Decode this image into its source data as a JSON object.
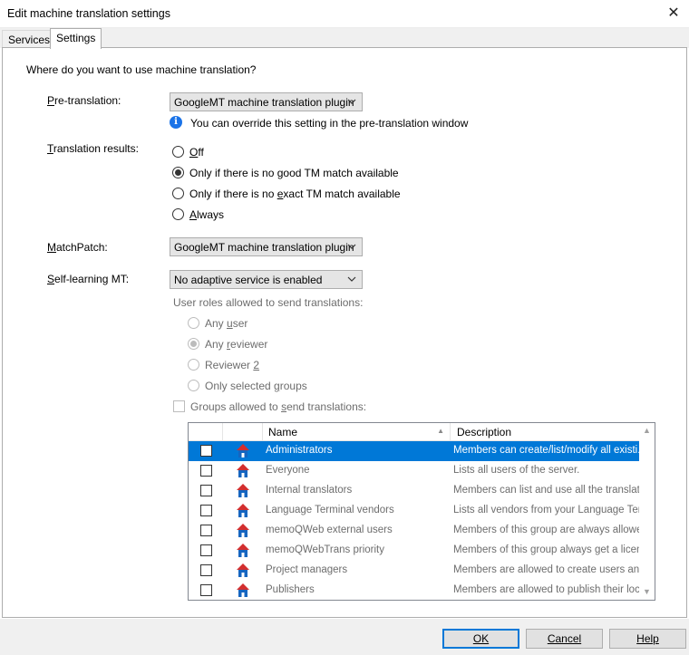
{
  "window": {
    "title": "Edit machine translation settings",
    "close_glyph": "✕"
  },
  "tabs": [
    {
      "label": "Services"
    },
    {
      "label": "Settings"
    }
  ],
  "settings": {
    "question": "Where do you want to use machine translation?",
    "pretranslation": {
      "label": "Pre-translation:",
      "value": "GoogleMT machine translation plugin",
      "info": "You can override this setting in the pre-translation window"
    },
    "translation_results": {
      "label": "Translation results:",
      "options": [
        "Off",
        "Only if there is no good TM match available",
        "Only if there is no exact TM match available",
        "Always"
      ],
      "selected_index": 1
    },
    "matchpatch": {
      "label": "MatchPatch:",
      "value": "GoogleMT machine translation plugin"
    },
    "selflearning": {
      "label": "Self-learning MT:",
      "value": "No adaptive service is enabled",
      "roles_label": "User roles allowed to send translations:",
      "roles": [
        "Any user",
        "Any reviewer",
        "Reviewer 2",
        "Only selected groups"
      ],
      "roles_selected_index": 1,
      "groups_label": "Groups allowed to send translations:"
    }
  },
  "groups_table": {
    "columns": {
      "name": "Name",
      "description": "Description"
    },
    "sort_glyph": "▲",
    "rows": [
      {
        "name": "Administrators",
        "description": "Members can create/list/modify all existi...",
        "selected": true
      },
      {
        "name": "Everyone",
        "description": "Lists all users of the server."
      },
      {
        "name": "Internal translators",
        "description": "Members can list and use all the translati..."
      },
      {
        "name": "Language Terminal vendors",
        "description": "Lists all vendors from your Language Ter..."
      },
      {
        "name": "memoQWeb external users",
        "description": "Members of this group are always allowe..."
      },
      {
        "name": "memoQWebTrans priority",
        "description": "Members of this group always get a licen..."
      },
      {
        "name": "Project managers",
        "description": "Members are allowed to create users an..."
      },
      {
        "name": "Publishers",
        "description": "Members are allowed to publish their loc..."
      }
    ],
    "colors": {
      "selection": "#0078d7",
      "icon_roof": "#d32f2f",
      "icon_body": "#1565c0"
    }
  },
  "footer": {
    "ok": "OK",
    "cancel": "Cancel",
    "help": "Help"
  }
}
